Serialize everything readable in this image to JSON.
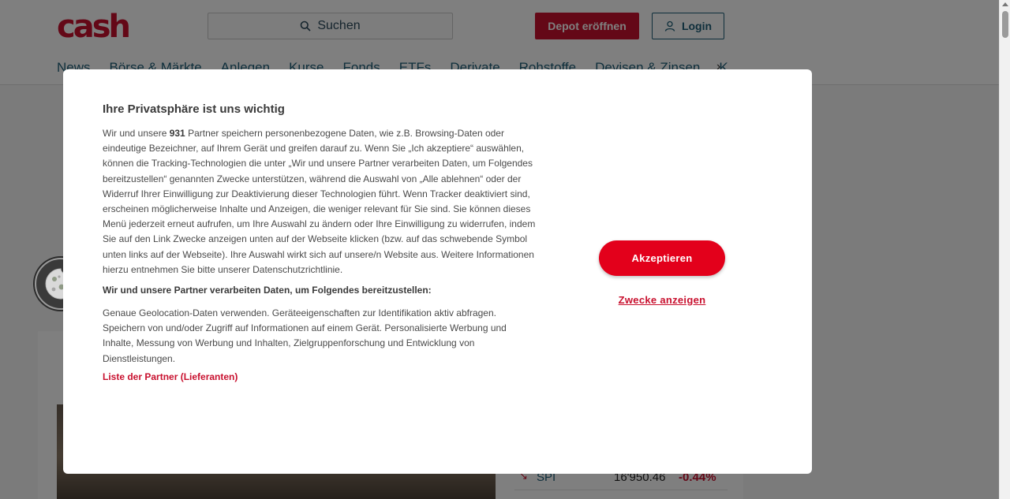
{
  "header": {
    "logo": "cash",
    "search_placeholder": "Suchen",
    "depot_button": "Depot eröffnen",
    "login_button": "Login"
  },
  "nav": {
    "items": [
      "News",
      "Börse & Märkte",
      "Anlegen",
      "Kurse",
      "Fonds",
      "ETFs",
      "Derivate",
      "Rohstoffe",
      "Devisen & Zinsen",
      "K"
    ]
  },
  "quote": {
    "name": "SPI",
    "value": "16'950.46",
    "change": "-0.44%"
  },
  "consent": {
    "title": "Ihre Privatsphäre ist uns wichtig",
    "intro_pre": "Wir und unsere ",
    "partner_count": "931",
    "intro_post": " Partner speichern personenbezogene Daten, wie z.B. Browsing-Daten oder eindeutige Bezeichner, auf Ihrem Gerät und greifen darauf zu. Wenn Sie „Ich akzeptiere“ auswählen, können die Tracking-Technologien die unter „Wir und unsere Partner verarbeiten Daten, um Folgendes bereitzustellen“ genannten Zwecke unterstützen, während die Auswahl von „Alle ablehnen“ oder der Widerruf Ihrer Einwilligung zur Deaktivierung dieser Technologien führt. Wenn Tracker deaktiviert sind, erscheinen möglicherweise Inhalte und Anzeigen, die weniger relevant für Sie sind. Sie können dieses Menü jederzeit erneut aufrufen, um Ihre Auswahl zu ändern oder Ihre Einwilligung zu widerrufen, indem Sie auf den Link Zwecke anzeigen unten auf der Webseite klicken (bzw. auf das schwebende Symbol unten links auf der Webseite). Ihre Auswahl wirkt sich auf unsere/n Website aus. Weitere Informationen hierzu entnehmen Sie bitte unserer Datenschutzrichtlinie.",
    "purposes_heading": "Wir und unsere Partner verarbeiten Daten, um Folgendes bereitzustellen:",
    "purposes_text": "Genaue Geolocation-Daten verwenden. Geräteeigenschaften zur Identifikation aktiv abfragen. Speichern von und/oder Zugriff auf Informationen auf einem Gerät. Personalisierte Werbung und Inhalte, Messung von Werbung und Inhalten, Zielgruppenforschung und Entwicklung von Dienstleistungen.",
    "partners_link": "Liste der Partner (Lieferanten)",
    "accept_button": "Akzeptieren",
    "purposes_link": "Zwecke anzeigen"
  },
  "colors": {
    "brand_red": "#c8102e",
    "accept_red": "#e3001b",
    "nav_teal": "#1f5f78"
  }
}
